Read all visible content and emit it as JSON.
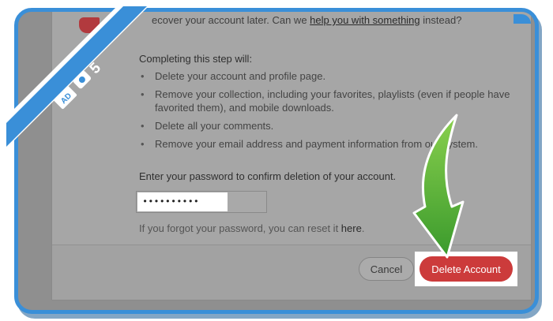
{
  "dialog": {
    "intro_prefix": "ecover your account later. Can we ",
    "intro_link": "help you with something",
    "intro_suffix": " instead?",
    "steps_title": "Completing this step will:",
    "steps": [
      "Delete your account and profile page.",
      "Remove your collection, including your favorites, playlists (even if people have favorited them), and mobile downloads.",
      "Delete all your comments.",
      "Remove your email address and payment information from our system."
    ],
    "password_label": "Enter your password to confirm deletion of your account.",
    "password_value": "••••••••••",
    "forgot_prefix": "If you forgot your password, you can reset it ",
    "forgot_link": "here",
    "forgot_suffix": ".",
    "cancel_label": "Cancel",
    "delete_label": "Delete Account"
  },
  "badge": {
    "step_number": "5",
    "logo_text": "AD",
    "color": "#3a8fd8"
  },
  "colors": {
    "frame_border": "#3a8fd8",
    "delete_button": "#cc3b3b",
    "arrow": "#5dbb3a"
  }
}
